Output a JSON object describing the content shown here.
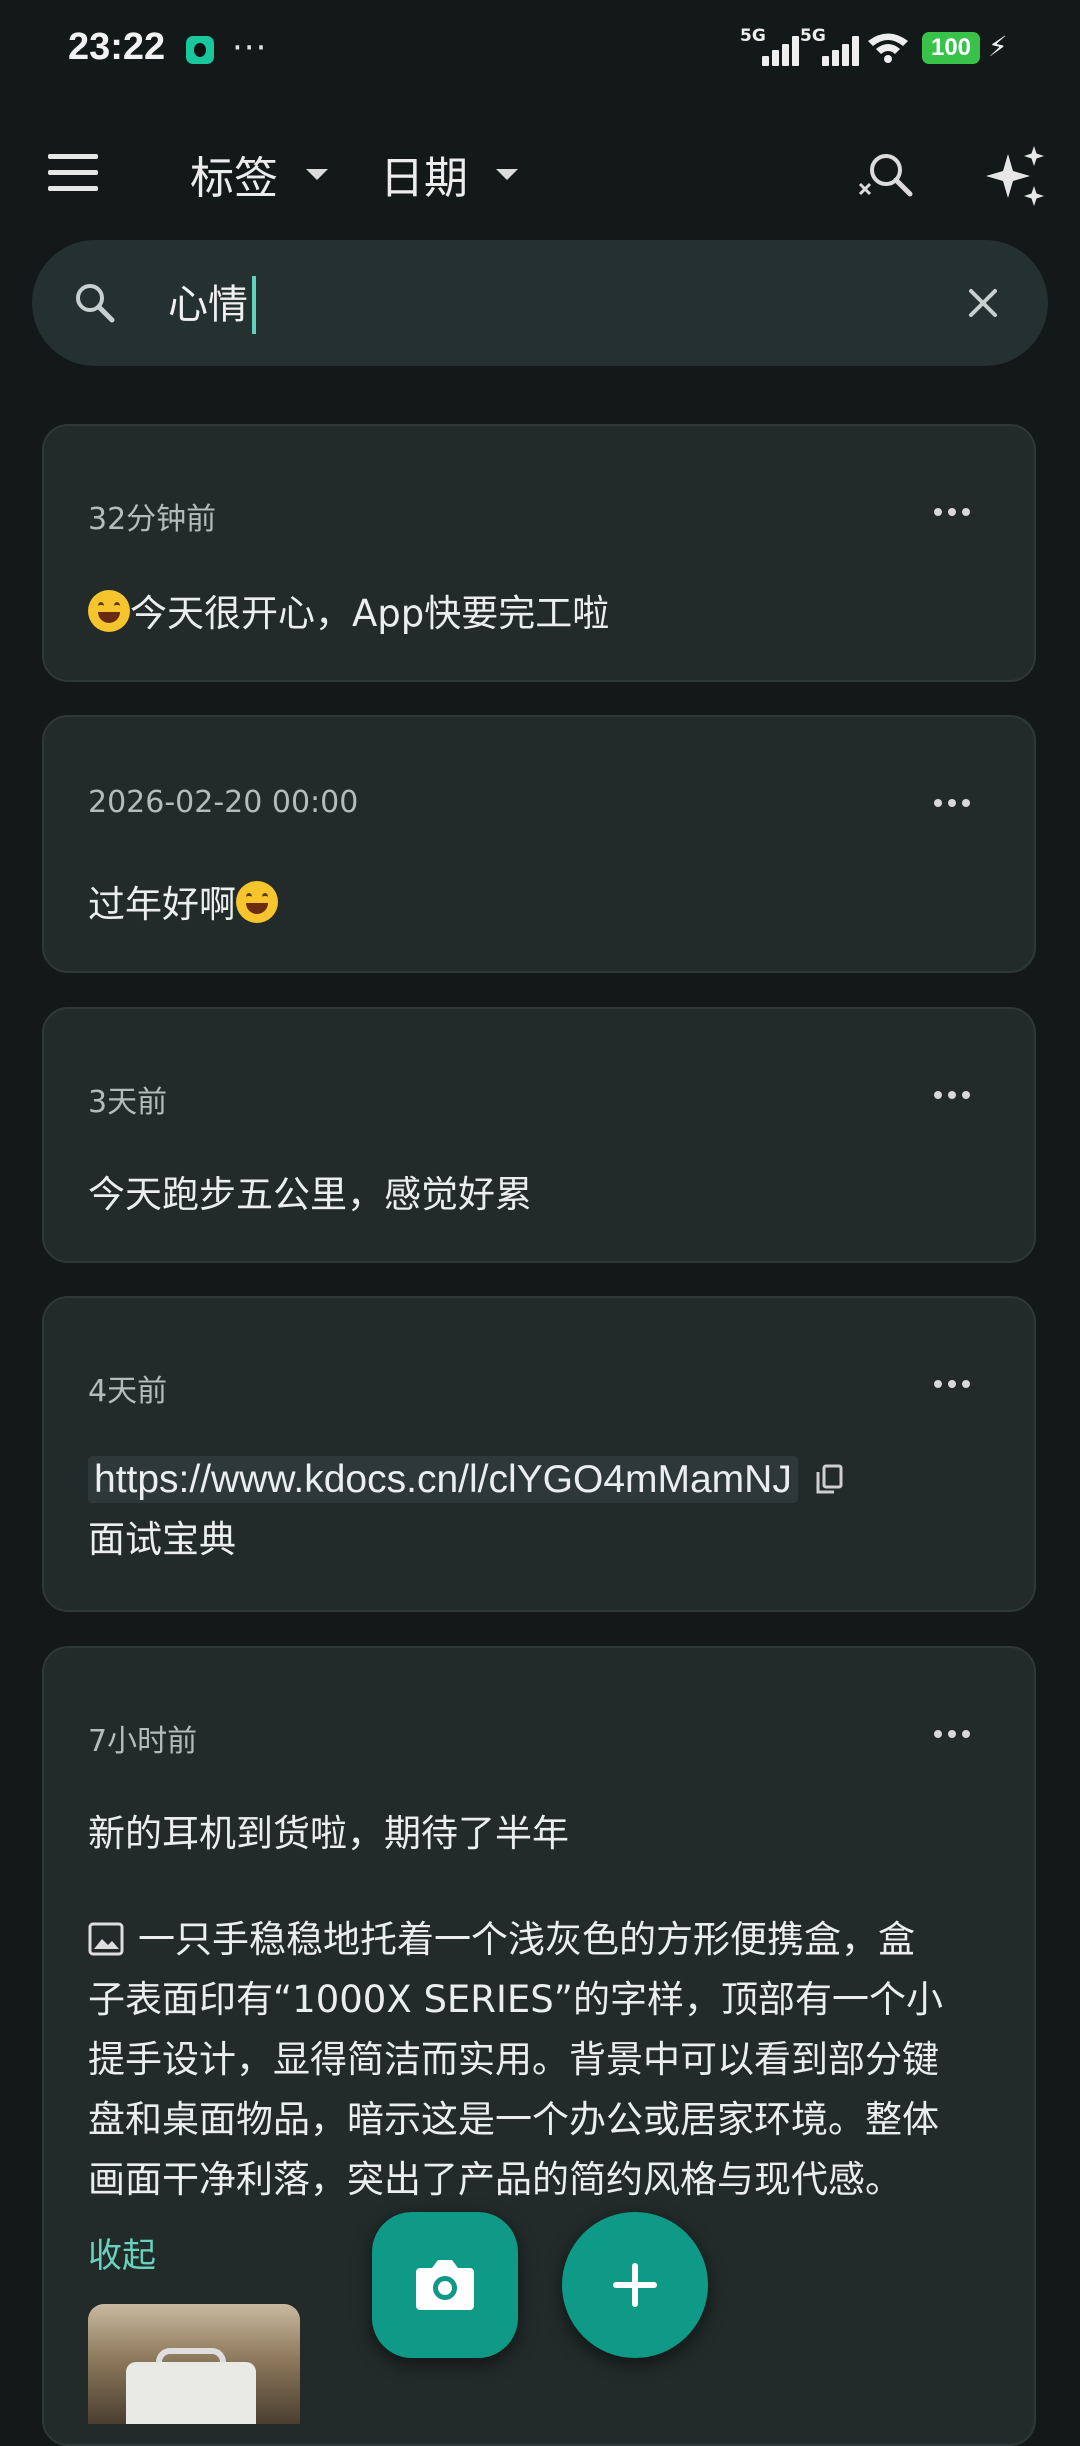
{
  "status_bar": {
    "time": "23:22",
    "more": "···",
    "signal_1": "5G",
    "signal_2": "5G",
    "battery": "100",
    "icons": [
      "app-notification-icon",
      "signal-icon",
      "wifi-icon",
      "battery-icon",
      "charging-icon"
    ]
  },
  "appbar": {
    "tags_label": "标签",
    "date_label": "日期",
    "icons": [
      "menu-icon",
      "caret-down-icon",
      "clear-search-icon",
      "sparkle-icon"
    ]
  },
  "search": {
    "query": "心情",
    "icons": [
      "search-icon",
      "close-icon"
    ]
  },
  "notes": [
    {
      "time": "32分钟前",
      "text": "今天很开心，App快要完工啦"
    },
    {
      "time": "2026-02-20 00:00",
      "text": "过年好啊"
    },
    {
      "time": "3天前",
      "text": "今天跑步五公里，感觉好累"
    },
    {
      "time": "4天前",
      "link": "https://www.kdocs.cn/l/clYGO4mMamNJ",
      "text": "面试宝典"
    },
    {
      "time": "7小时前",
      "text": "新的耳机到货啦，期待了半年",
      "image_caption_1": "一只手稳稳地托着一个浅灰色的方形便携盒，盒",
      "image_caption_2": "子表面印有“1000X SERIES”的字样，顶部有一个小",
      "image_caption_3": "提手设计，显得简洁而实用。背景中可以看到部分键",
      "image_caption_4": "盘和桌面物品，暗示这是一个办公或居家环境。整体",
      "image_caption_5": "画面干净利落，突出了产品的简约风格与现代感。",
      "collapse_label": "收起"
    }
  ],
  "colors": {
    "background": "#131918",
    "card": "#222a2a",
    "accent": "#0e9a86",
    "accent_text": "#68d2bf"
  }
}
